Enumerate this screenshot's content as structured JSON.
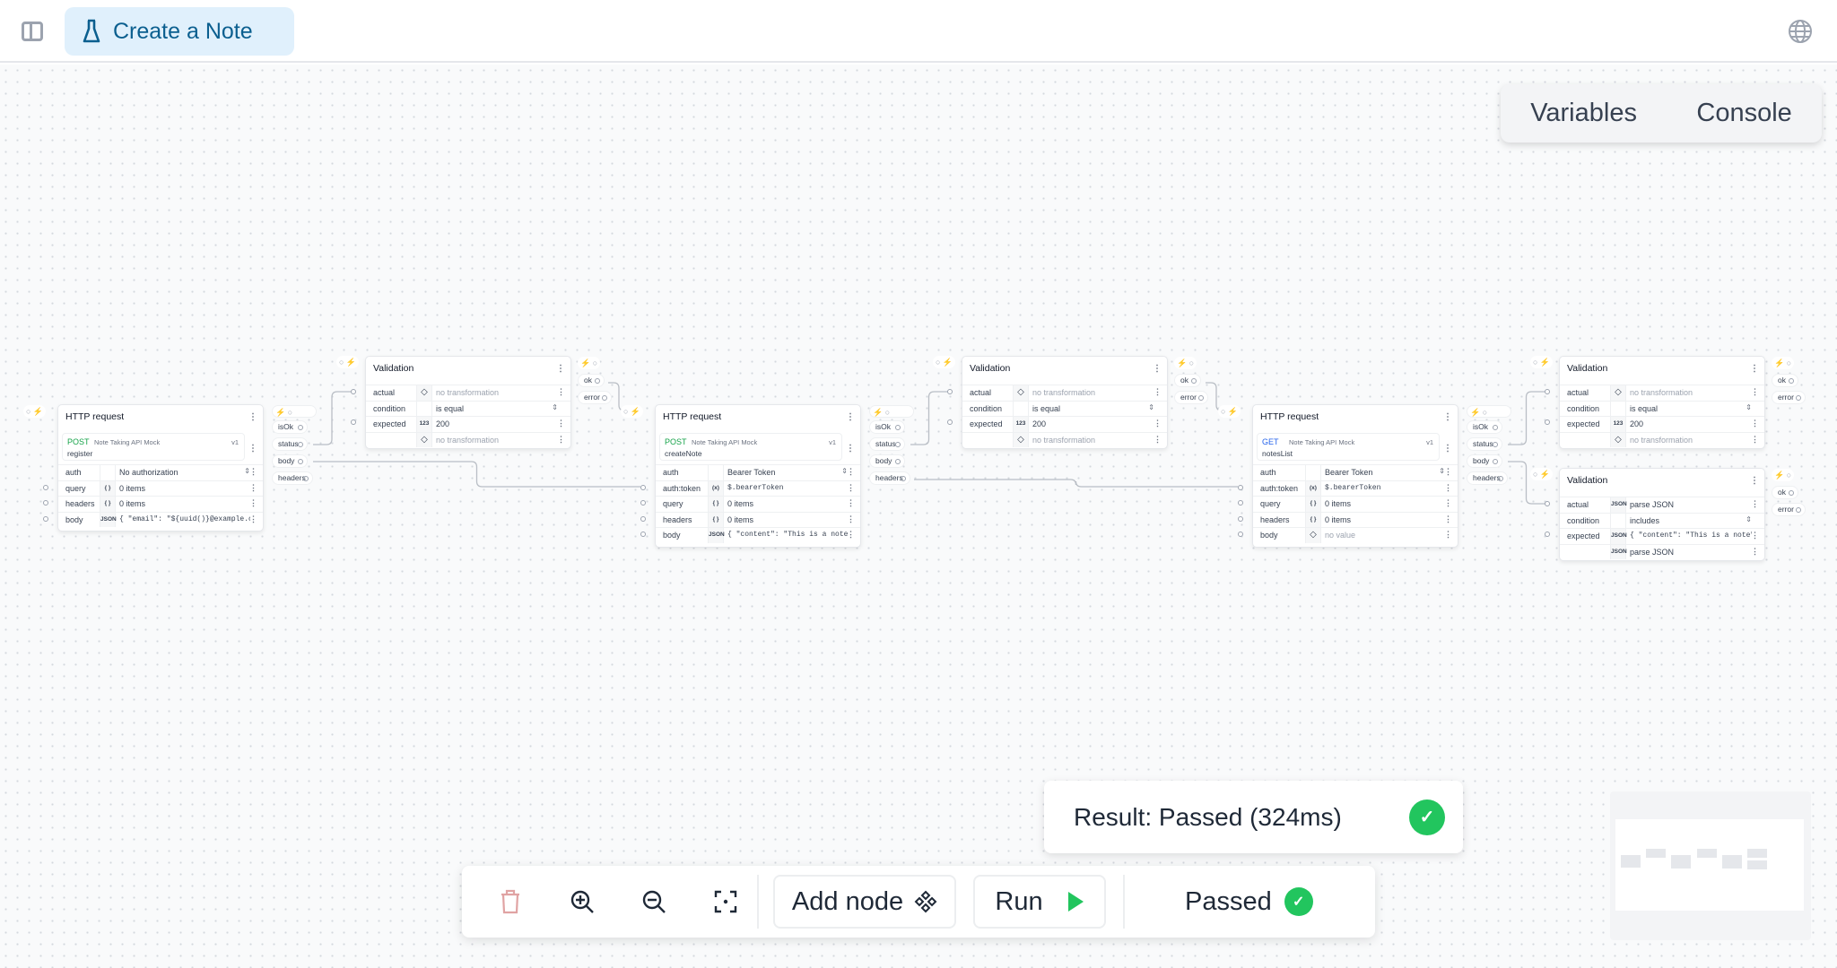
{
  "header": {
    "title": "Create a Note",
    "title_icon": "flask-icon",
    "sidebar_icon": "sidebar-toggle-icon",
    "globe_icon": "globe-icon"
  },
  "panel_tabs": [
    "Variables",
    "Console"
  ],
  "http_nodes": [
    {
      "title": "HTTP request",
      "method": "POST",
      "method_color": "#16a34a",
      "api": "Note Taking API Mock",
      "version": "v1",
      "operation": "register",
      "rows": [
        {
          "label": "auth",
          "icon": "",
          "value": "No authorization",
          "select": true
        },
        {
          "label": "query",
          "icon": "braces",
          "value": "0 items"
        },
        {
          "label": "headers",
          "icon": "braces",
          "value": "0 items"
        },
        {
          "label": "body",
          "icon": "json",
          "value": "{ \"email\": \"${uuid()}@example.cc",
          "mono": true
        }
      ]
    },
    {
      "title": "HTTP request",
      "method": "POST",
      "method_color": "#16a34a",
      "api": "Note Taking API Mock",
      "version": "v1",
      "operation": "createNote",
      "rows": [
        {
          "label": "auth",
          "icon": "",
          "value": "Bearer Token",
          "select": true
        },
        {
          "label": "auth:token",
          "icon": "variable",
          "value": "$.bearerToken",
          "mono": true
        },
        {
          "label": "query",
          "icon": "braces",
          "value": "0 items"
        },
        {
          "label": "headers",
          "icon": "braces",
          "value": "0 items"
        },
        {
          "label": "body",
          "icon": "json",
          "value": "{ \"content\": \"This is a note\"",
          "mono": true
        }
      ]
    },
    {
      "title": "HTTP request",
      "method": "GET",
      "method_color": "#2563eb",
      "api": "Note Taking API Mock",
      "version": "v1",
      "operation": "notesList",
      "rows": [
        {
          "label": "auth",
          "icon": "",
          "value": "Bearer Token",
          "select": true
        },
        {
          "label": "auth:token",
          "icon": "variable",
          "value": "$.bearerToken",
          "mono": true
        },
        {
          "label": "query",
          "icon": "braces",
          "value": "0 items"
        },
        {
          "label": "headers",
          "icon": "braces",
          "value": "0 items"
        },
        {
          "label": "body",
          "icon": "diamond",
          "value": "no value",
          "muted": true
        }
      ]
    }
  ],
  "http_outputs": [
    "isOk",
    "status",
    "body",
    "headers"
  ],
  "validation_nodes": [
    {
      "title": "Validation",
      "rows": [
        {
          "label": "actual",
          "icon": "diamond",
          "value": "no transformation",
          "muted": true
        },
        {
          "label": "condition",
          "icon": "",
          "value": "is equal",
          "select": true
        },
        {
          "label": "expected",
          "icon": "number",
          "value": "200"
        },
        {
          "label": "",
          "icon": "diamond",
          "value": "no transformation",
          "muted": true
        }
      ]
    },
    {
      "title": "Validation",
      "rows": [
        {
          "label": "actual",
          "icon": "diamond",
          "value": "no transformation",
          "muted": true
        },
        {
          "label": "condition",
          "icon": "",
          "value": "is equal",
          "select": true
        },
        {
          "label": "expected",
          "icon": "number",
          "value": "200"
        },
        {
          "label": "",
          "icon": "diamond",
          "value": "no transformation",
          "muted": true
        }
      ]
    },
    {
      "title": "Validation",
      "rows": [
        {
          "label": "actual",
          "icon": "diamond",
          "value": "no transformation",
          "muted": true
        },
        {
          "label": "condition",
          "icon": "",
          "value": "is equal",
          "select": true
        },
        {
          "label": "expected",
          "icon": "number",
          "value": "200"
        },
        {
          "label": "",
          "icon": "diamond",
          "value": "no transformation",
          "muted": true
        }
      ]
    },
    {
      "title": "Validation",
      "rows": [
        {
          "label": "actual",
          "icon": "json",
          "value": "parse JSON"
        },
        {
          "label": "condition",
          "icon": "",
          "value": "includes",
          "select": true
        },
        {
          "label": "expected",
          "icon": "json",
          "value": "{ \"content\": \"This is a note\", \"id",
          "mono": true
        },
        {
          "label": "",
          "icon": "json",
          "value": "parse JSON"
        }
      ]
    }
  ],
  "validation_outputs": [
    "ok",
    "error"
  ],
  "result_toast": {
    "text": "Result: Passed (324ms)",
    "status_color": "#22c55e"
  },
  "toolbar": {
    "icons": [
      "trash-icon",
      "zoom-in-icon",
      "zoom-out-icon",
      "fit-view-icon"
    ],
    "add_node": "Add node",
    "run": "Run",
    "status": "Passed"
  }
}
